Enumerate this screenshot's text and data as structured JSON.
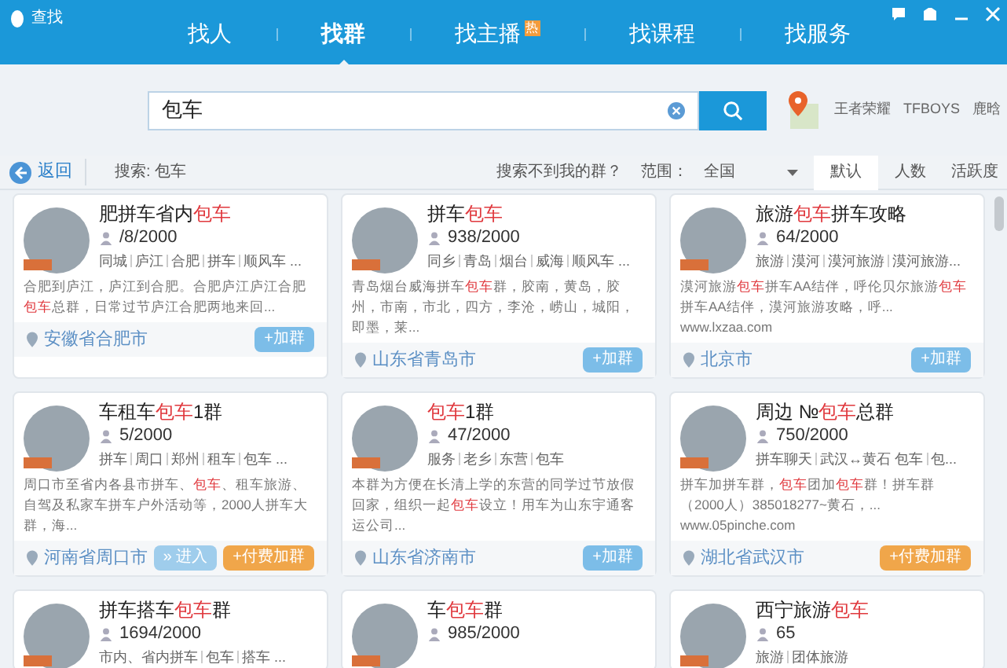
{
  "window": {
    "title": "查找"
  },
  "tabs": [
    {
      "label": "找人",
      "selected": false
    },
    {
      "label": "找群",
      "selected": true
    },
    {
      "label": "找主播",
      "selected": false,
      "badge": "热"
    },
    {
      "label": "找课程",
      "selected": false
    },
    {
      "label": "找服务",
      "selected": false
    }
  ],
  "search": {
    "value": "包车"
  },
  "hot_words": [
    "王者荣耀",
    "TFBOYS",
    "鹿晗"
  ],
  "toolbar": {
    "back": "返回",
    "query": "搜索: 包车",
    "not_found": "搜索不到我的群？",
    "scope_label": "范围：",
    "scope_value": "全国",
    "sort_tabs": [
      {
        "label": "默认",
        "selected": true
      },
      {
        "label": "人数",
        "selected": false
      },
      {
        "label": "活跃度",
        "selected": false
      }
    ]
  },
  "groups": [
    {
      "name": [
        {
          "text": "肥拼车省内"
        },
        {
          "text": "包车",
          "highlight": true
        }
      ],
      "members": "/8/2000",
      "tags": [
        "同城",
        "庐江",
        "合肥",
        "拼车",
        "顺风车 ..."
      ],
      "description": [
        {
          "text": "合肥到庐江，庐江到合肥。合肥庐江庐江合肥"
        },
        {
          "text": "包车",
          "highlight": true
        },
        {
          "text": "总群，日常过节庐江合肥两地来回..."
        }
      ],
      "location": "安徽省合肥市",
      "buttons": [
        {
          "kind": "join",
          "label": "+加群"
        }
      ]
    },
    {
      "name": [
        {
          "text": "拼车"
        },
        {
          "text": "包车",
          "highlight": true
        }
      ],
      "members": "938/2000",
      "tags": [
        "同乡",
        "青岛",
        "烟台",
        "威海",
        "顺风车 ..."
      ],
      "description": [
        {
          "text": "青岛烟台威海拼车"
        },
        {
          "text": "包车",
          "highlight": true
        },
        {
          "text": "群，胶南，黄岛，胶州，市南，市北，四方，李沧，崂山，城阳，即墨，莱..."
        }
      ],
      "location": "山东省青岛市",
      "buttons": [
        {
          "kind": "join",
          "label": "+加群"
        }
      ]
    },
    {
      "name": [
        {
          "text": "旅游"
        },
        {
          "text": "包车",
          "highlight": true
        },
        {
          "text": "拼车攻略"
        }
      ],
      "members": "64/2000",
      "tags": [
        "旅游",
        "漠河",
        "漠河旅游",
        "漠河旅游..."
      ],
      "description": [
        {
          "text": "漠河旅游"
        },
        {
          "text": "包车",
          "highlight": true
        },
        {
          "text": "拼车AA结伴，呼伦贝尔旅游"
        },
        {
          "text": "包车",
          "highlight": true
        },
        {
          "text": "拼车AA结伴，漠河旅游攻略，呼... www.lxzaa.com"
        }
      ],
      "location": "北京市",
      "buttons": [
        {
          "kind": "join",
          "label": "+加群"
        }
      ]
    },
    {
      "name": [
        {
          "text": "车租车"
        },
        {
          "text": "包车",
          "highlight": true
        },
        {
          "text": "1群"
        }
      ],
      "members": "5/2000",
      "tags": [
        "拼车",
        "周口",
        "郑州",
        "租车",
        "包车 ..."
      ],
      "description": [
        {
          "text": "周口市至省内各县市拼车、"
        },
        {
          "text": "包车",
          "highlight": true
        },
        {
          "text": "、租车旅游、自驾及私家车拼车户外活动等，2000人拼车大群，海..."
        }
      ],
      "location": "河南省周口市",
      "buttons": [
        {
          "kind": "enter",
          "label": "» 进入"
        },
        {
          "kind": "paid",
          "label": "+付费加群"
        }
      ]
    },
    {
      "name": [
        {
          "text": "包车",
          "highlight": true
        },
        {
          "text": "1群"
        }
      ],
      "members": "47/2000",
      "tags": [
        "服务",
        "老乡",
        "东营",
        "包车"
      ],
      "description": [
        {
          "text": "本群为方便在长清上学的东营的同学过节放假回家，组织一起"
        },
        {
          "text": "包车",
          "highlight": true
        },
        {
          "text": "设立！用车为山东宇通客运公司..."
        }
      ],
      "location": "山东省济南市",
      "buttons": [
        {
          "kind": "join",
          "label": "+加群"
        }
      ]
    },
    {
      "name": [
        {
          "text": "周边 №"
        },
        {
          "text": "包车",
          "highlight": true
        },
        {
          "text": "总群"
        }
      ],
      "members": "750/2000",
      "tags": [
        "拼车聊天",
        "武汉↔黄石 包车",
        "包..."
      ],
      "description": [
        {
          "text": "拼车加拼车群，"
        },
        {
          "text": "包车",
          "highlight": true
        },
        {
          "text": "团加"
        },
        {
          "text": "包车",
          "highlight": true
        },
        {
          "text": "群！拼车群（2000人）385018277~黄石，... www.05pinche.com"
        }
      ],
      "location": "湖北省武汉市",
      "buttons": [
        {
          "kind": "paid",
          "label": "+付费加群"
        }
      ]
    },
    {
      "name": [
        {
          "text": "拼车搭车"
        },
        {
          "text": "包车",
          "highlight": true
        },
        {
          "text": "群"
        }
      ],
      "members": "1694/2000",
      "tags": [
        "市内、省内拼车",
        "包车",
        "搭车 ..."
      ]
    },
    {
      "name": [
        {
          "text": "车"
        },
        {
          "text": "包车",
          "highlight": true
        },
        {
          "text": "群"
        }
      ],
      "members": "985/2000"
    },
    {
      "name": [
        {
          "text": "西宁旅游"
        },
        {
          "text": "包车",
          "highlight": true
        }
      ],
      "members": "65",
      "tags": [
        "旅游",
        "团体旅游"
      ]
    }
  ]
}
